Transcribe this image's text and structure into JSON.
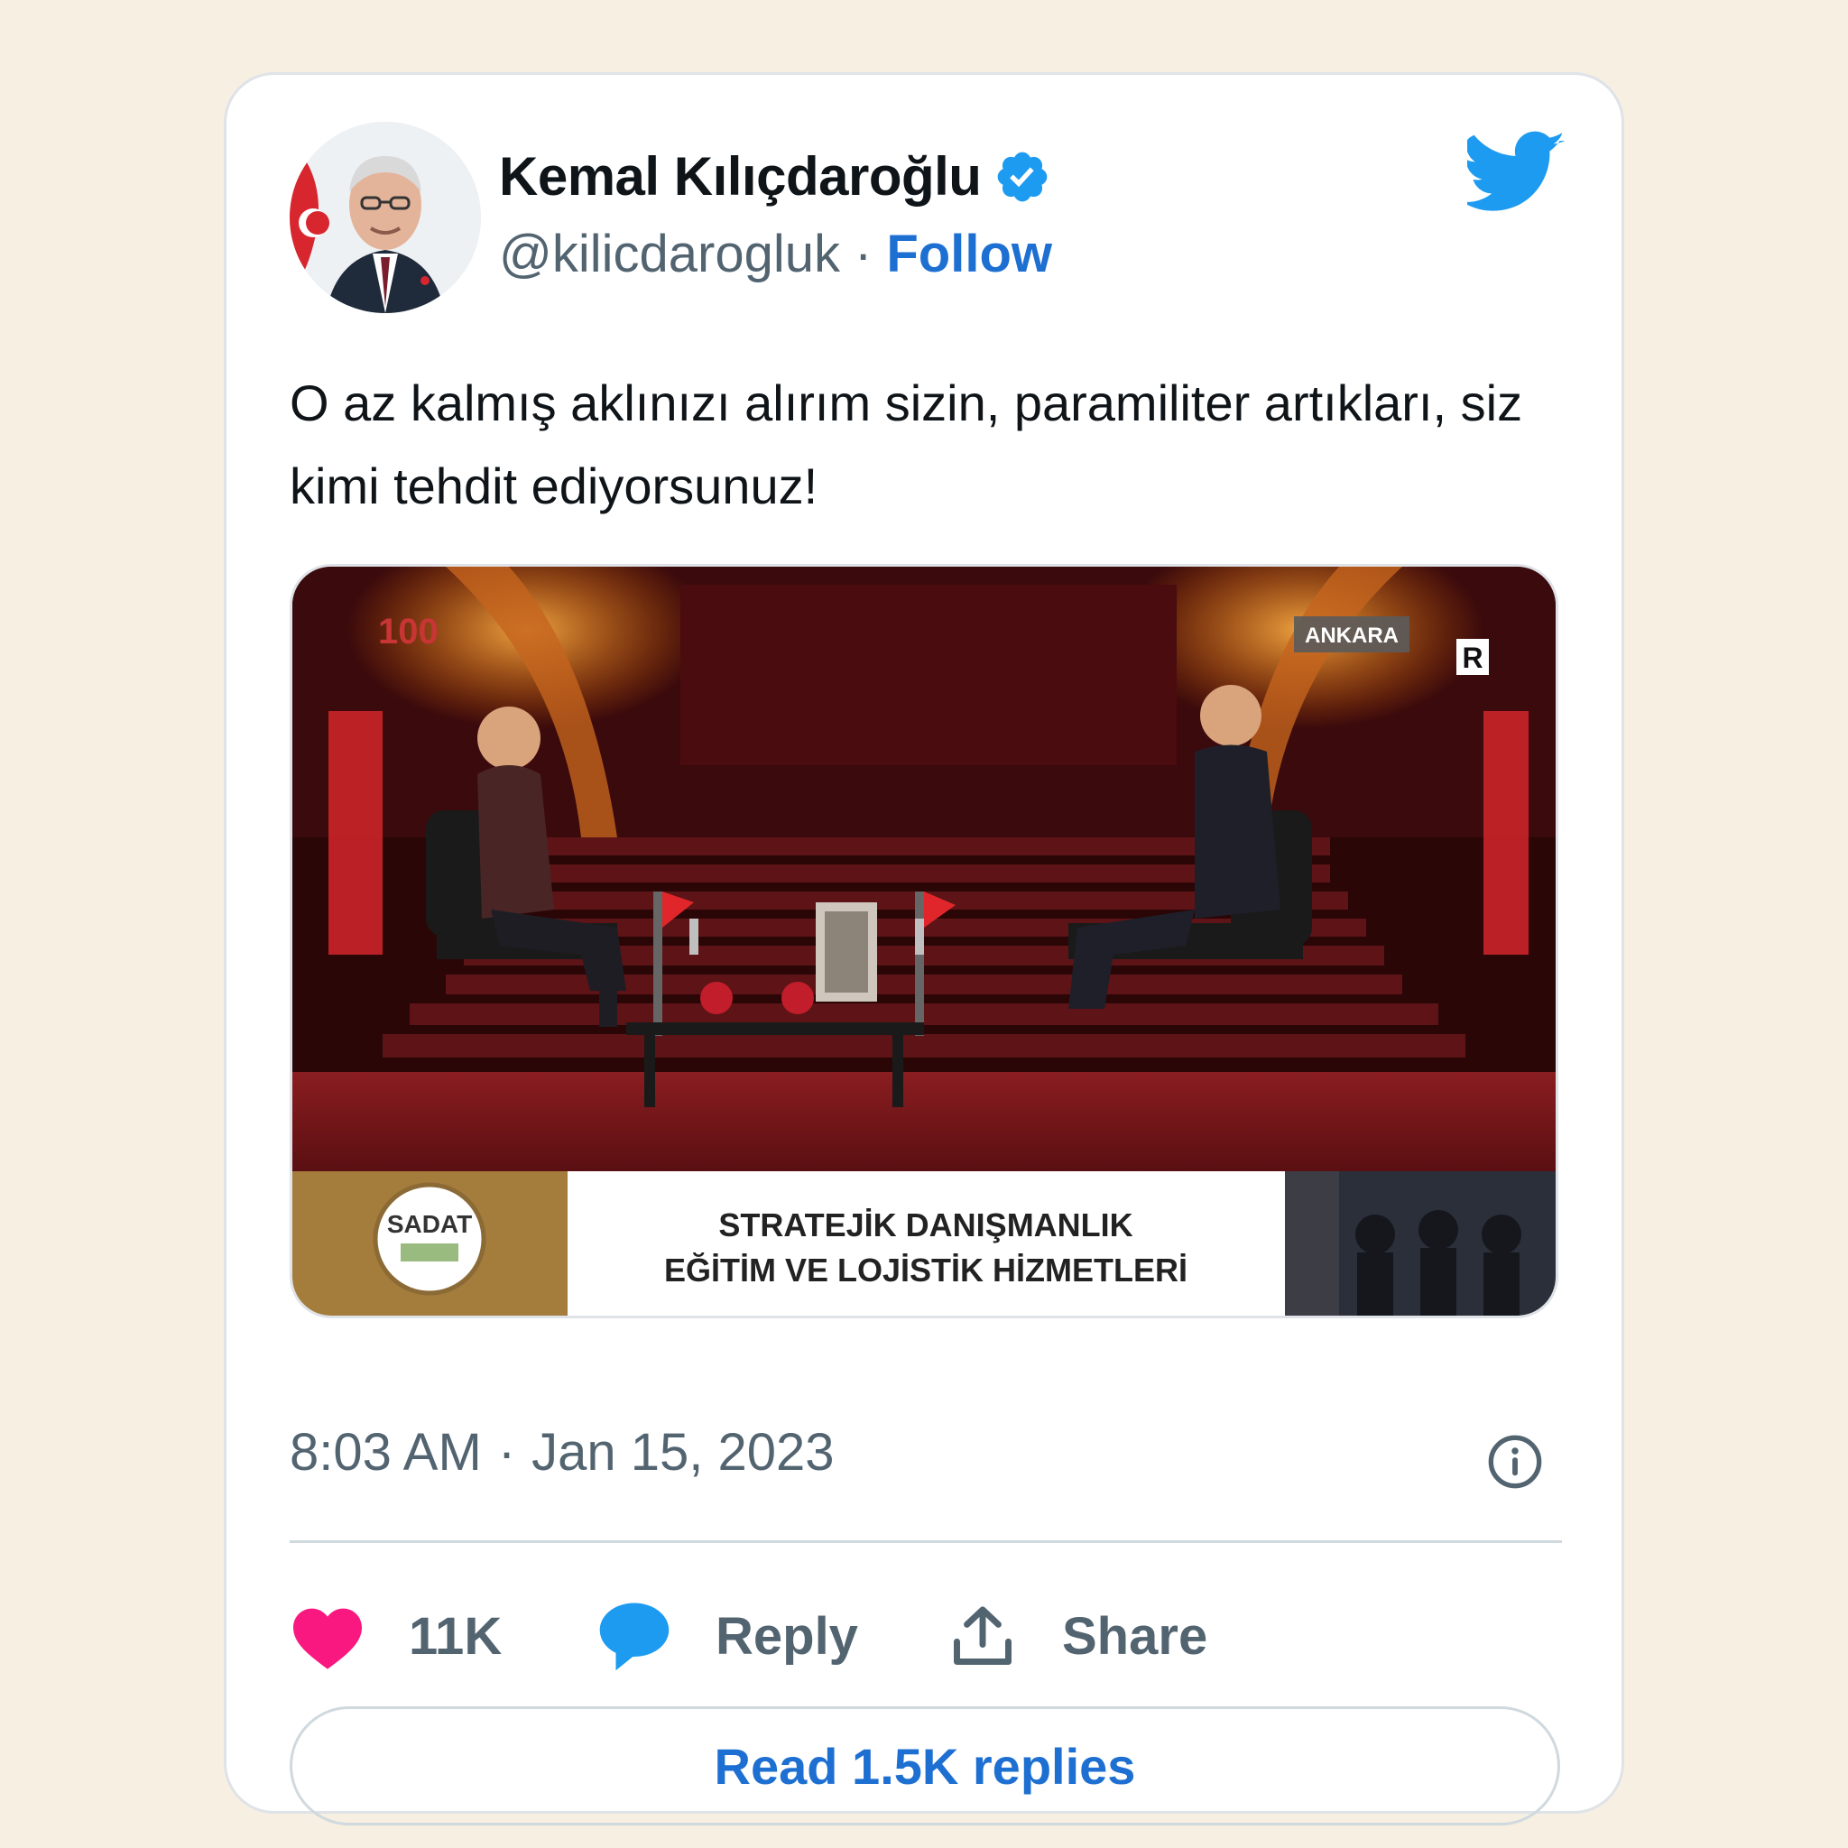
{
  "tweet": {
    "author_name": "Kemal Kılıçdaroğlu",
    "handle": "@kilicdarogluk",
    "separator": "·",
    "follow_label": "Follow",
    "text": "O az kalmış aklınızı alırım sizin, paramiliter artıkları, siz kimi tehdit ediyorsunuz!",
    "time": "8:03 AM",
    "date": "Jan 15, 2023",
    "verified": true
  },
  "media": {
    "logo_text": "100",
    "location_badge": "ANKARA",
    "channel_mark": "R",
    "banner_logo": "SADAT",
    "banner_line1": "STRATEJİK DANIŞMANLIK",
    "banner_line2": "EĞİTİM VE LOJİSTİK HİZMETLERİ"
  },
  "actions": {
    "like_count": "11K",
    "reply_label": "Reply",
    "share_label": "Share"
  },
  "read_replies_label": "Read 1.5K replies",
  "colors": {
    "background": "#f6efe2",
    "accent_blue": "#1d6fd1",
    "twitter_blue": "#1d9bf0",
    "like_pink": "#f91880",
    "text_primary": "#0f1419",
    "text_secondary": "#536471"
  },
  "icons": [
    "verified-badge-icon",
    "twitter-bird-icon",
    "info-icon",
    "heart-icon",
    "reply-bubble-icon",
    "share-icon"
  ]
}
